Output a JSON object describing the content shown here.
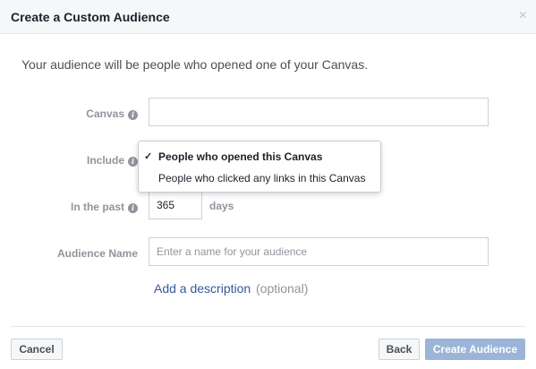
{
  "dialog": {
    "title": "Create a Custom Audience",
    "close_glyph": "×",
    "intro": "Your audience will be people who opened one of your Canvas."
  },
  "form": {
    "canvas_label": "Canvas",
    "canvas_value": "",
    "include_label": "Include",
    "include_options": [
      {
        "label": "People who opened this Canvas",
        "selected": true
      },
      {
        "label": "People who clicked any links in this Canvas",
        "selected": false
      }
    ],
    "past_label": "In the past",
    "past_value": "365",
    "days_label": "days",
    "audience_name_label": "Audience Name",
    "audience_name_placeholder": "Enter a name for your audience",
    "add_description_link": "Add a description",
    "optional_text": "(optional)"
  },
  "footer": {
    "cancel": "Cancel",
    "back": "Back",
    "create": "Create Audience"
  },
  "icons": {
    "info": "i",
    "check": "✓"
  },
  "colors": {
    "link": "#365899",
    "primary_disabled": "#9cb4d8",
    "label_gray": "#90949c"
  }
}
